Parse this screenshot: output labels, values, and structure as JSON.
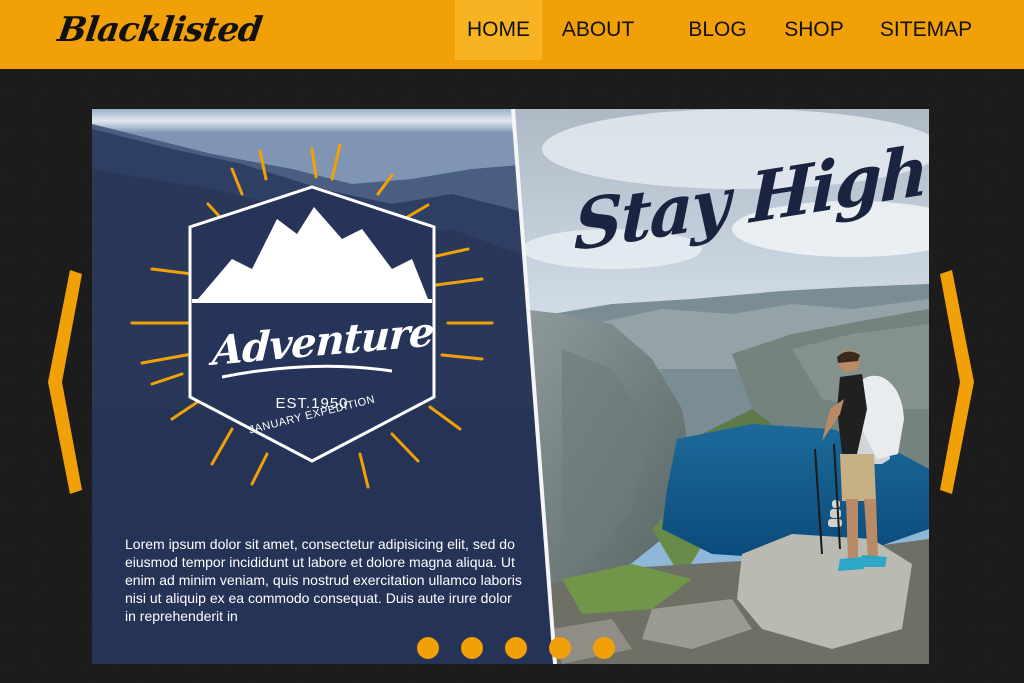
{
  "header": {
    "logo": "Blacklisted",
    "nav": [
      {
        "label": "HOME",
        "active": true
      },
      {
        "label": "ABOUT",
        "active": false
      },
      {
        "label": "BLOG",
        "active": false
      },
      {
        "label": "SHOP",
        "active": false
      },
      {
        "label": "SITEMAP",
        "active": false
      }
    ]
  },
  "slide": {
    "title": "Stay High",
    "badge": {
      "word": "Adventure",
      "est": "EST.1950",
      "sub": "JANUARY EXPEDITION"
    },
    "text": "Lorem ipsum dolor sit amet, consectetur adipisicing elit, sed do eiusmod tempor incididunt ut labore et dolore magna aliqua. Ut enim ad minim veniam, quis nostrud exercitation ullamco laboris nisi ut aliquip ex ea commodo consequat. Duis aute irure dolor in reprehenderit in",
    "dots": 5,
    "active_dot": 0
  },
  "controls": {
    "prev_icon": "chevron-left-icon",
    "next_icon": "chevron-right-icon"
  },
  "colors": {
    "accent": "#f1a007",
    "panel": "#27365a",
    "background": "#1c1c1d",
    "title": "#1a2440"
  }
}
